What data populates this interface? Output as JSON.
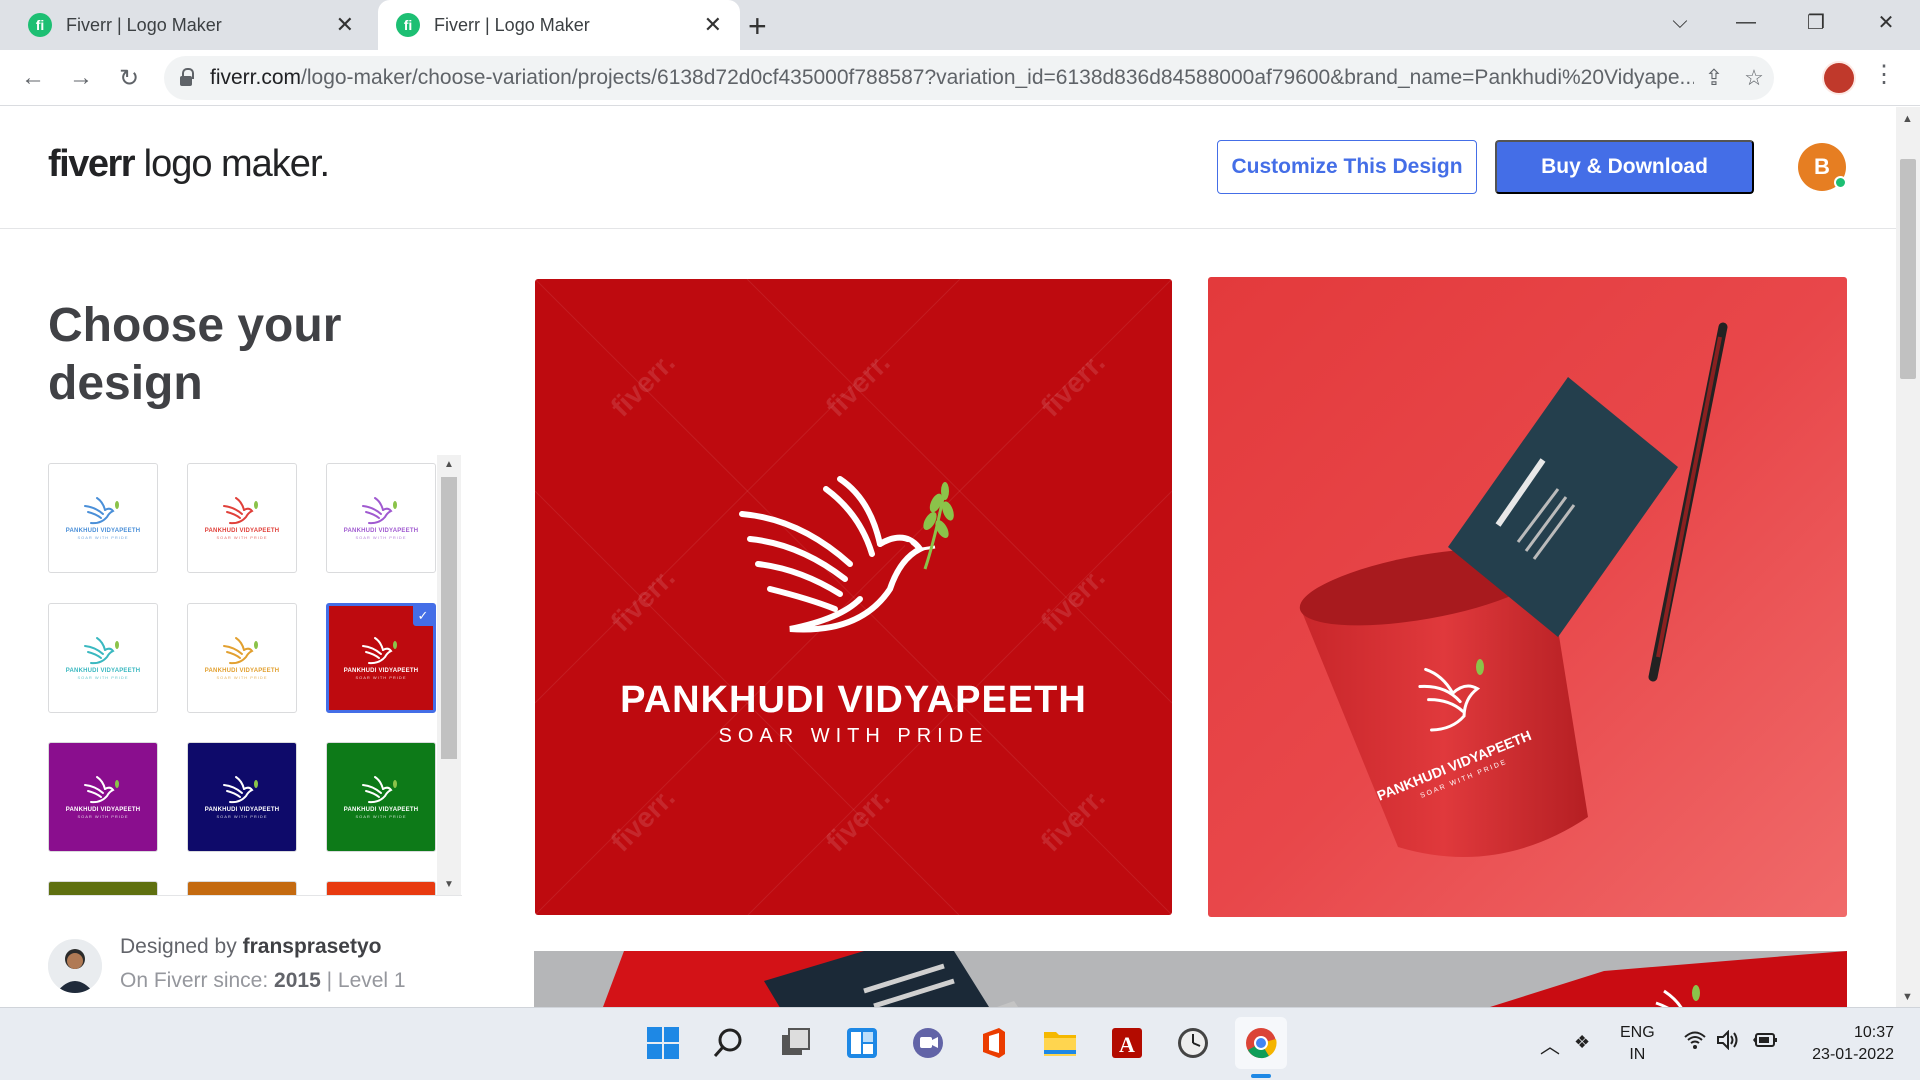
{
  "browser": {
    "tabs": [
      {
        "title": "Fiverr | Logo Maker",
        "favicon": "fi",
        "active": false
      },
      {
        "title": "Fiverr | Logo Maker",
        "favicon": "fi",
        "active": true
      }
    ],
    "new_tab": "+",
    "url_host": "fiverr.com",
    "url_path": "/logo-maker/choose-variation/projects/6138d72d0cf435000f788587?variation_id=6138d836d84588000af79600&brand_name=Pankhudi%20Vidyape..."
  },
  "header": {
    "logo_bold": "fiverr",
    "logo_rest": " logo maker.",
    "customize_button": "Customize This Design",
    "buy_button": "Buy & Download",
    "avatar_letter": "B"
  },
  "sidebar": {
    "heading": "Choose your design",
    "variations": [
      {
        "bg": "#ffffff",
        "fg": "#4a8fd8",
        "selected": false
      },
      {
        "bg": "#ffffff",
        "fg": "#e0403a",
        "selected": false
      },
      {
        "bg": "#ffffff",
        "fg": "#a05ad0",
        "selected": false
      },
      {
        "bg": "#ffffff",
        "fg": "#3ab8c0",
        "selected": false
      },
      {
        "bg": "#ffffff",
        "fg": "#e2a030",
        "selected": false
      },
      {
        "bg": "#be0a0f",
        "fg": "#ffffff",
        "selected": true
      },
      {
        "bg": "#8a0e8e",
        "fg": "#ffffff",
        "selected": false
      },
      {
        "bg": "#0e0a6a",
        "fg": "#ffffff",
        "selected": false
      },
      {
        "bg": "#0d7a18",
        "fg": "#ffffff",
        "selected": false
      },
      {
        "bg": "#5f7010",
        "fg": "#ffffff",
        "selected": false
      },
      {
        "bg": "#c46a10",
        "fg": "#ffffff",
        "selected": false
      },
      {
        "bg": "#e83a10",
        "fg": "#ffffff",
        "selected": false
      }
    ],
    "thumb_name": "PANKHUDI VIDYAPEETH",
    "thumb_slogan": "SOAR WITH PRIDE",
    "designer_label": "Designed by",
    "designer_name": "fransprasetyo",
    "since_label": "On Fiverr since:",
    "since_year": "2015",
    "level": "| Level 1"
  },
  "preview": {
    "brand_name": "PANKHUDI VIDYAPEETH",
    "slogan": "SOAR WITH PRIDE",
    "watermark": "fiverr.",
    "background": "#be0a0f",
    "mock_name": "PANKHUDI VIDYAPEETH",
    "mock_slogan": "SOAR WITH PRIDE"
  },
  "taskbar": {
    "lang_line1": "ENG",
    "lang_line2": "IN",
    "time": "10:37",
    "date": "23-01-2022"
  }
}
